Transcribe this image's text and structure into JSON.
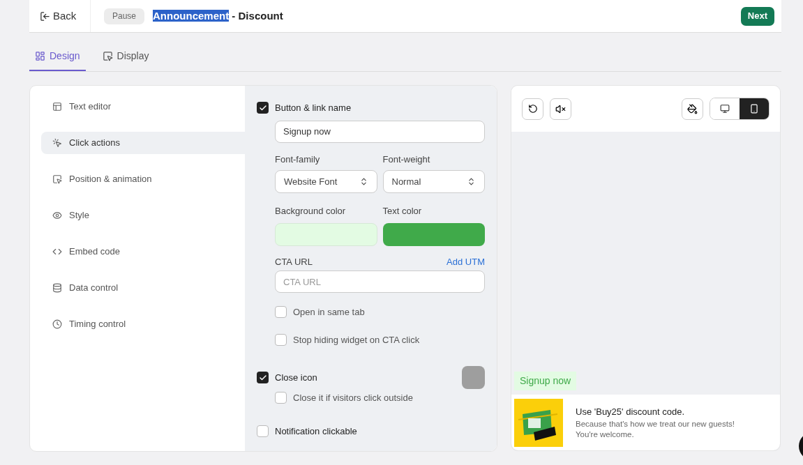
{
  "header": {
    "back": "Back",
    "pause": "Pause",
    "title_highlighted": "Announcement",
    "title_rest": " - Discount",
    "next": "Next"
  },
  "tabs": [
    {
      "label": "Design",
      "selected": true,
      "kind": "design"
    },
    {
      "label": "Display",
      "selected": false,
      "kind": "display"
    }
  ],
  "sidebar": {
    "items": [
      {
        "label": "Text editor",
        "selected": false,
        "kind": "text"
      },
      {
        "label": "Click actions",
        "selected": true,
        "kind": "click"
      },
      {
        "label": "Position & animation",
        "selected": false,
        "kind": "position"
      },
      {
        "label": "Style",
        "selected": false,
        "kind": "style"
      },
      {
        "label": "Embed code",
        "selected": false,
        "kind": "code"
      },
      {
        "label": "Data control",
        "selected": false,
        "kind": "data"
      },
      {
        "label": "Timing control",
        "selected": false,
        "kind": "timing"
      }
    ]
  },
  "button_link": {
    "label": "Button & link name",
    "checked": true,
    "value": "Signup now",
    "font_family": {
      "label": "Font-family",
      "value": "Website Font"
    },
    "font_weight": {
      "label": "Font-weight",
      "value": "Normal"
    },
    "background_color": {
      "label": "Background color",
      "color": "#e3fbe3"
    },
    "text_color": {
      "label": "Text color",
      "color": "#40aa4a"
    },
    "cta_url": {
      "label": "CTA URL",
      "link": "Add UTM",
      "placeholder": "CTA URL"
    },
    "options": [
      {
        "label": "Open in same tab",
        "checked": false
      },
      {
        "label": "Stop hiding widget on CTA click",
        "checked": false
      }
    ]
  },
  "close_icon": {
    "label": "Close icon",
    "checked": true,
    "color": "#9e9e9e",
    "options": [
      {
        "label": "Close it if visitors click outside",
        "checked": false
      }
    ]
  },
  "notification_clickable": {
    "label": "Notification clickable",
    "checked": false
  },
  "preview": {
    "devices": [
      {
        "kind": "desktop",
        "selected": false
      },
      {
        "kind": "mobile",
        "selected": true
      }
    ],
    "cta": "Signup now",
    "notification": {
      "title": "Use 'Buy25' discount code.",
      "body": "Because that's how we treat our new guests! You're welcome."
    }
  }
}
